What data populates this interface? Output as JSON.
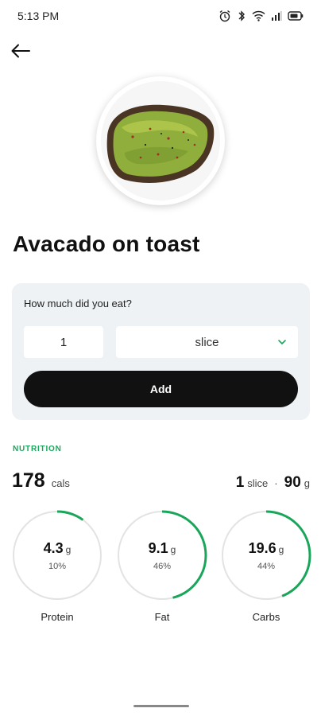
{
  "status_bar": {
    "time": "5:13 PM"
  },
  "food": {
    "title": "Avacado on toast"
  },
  "portion": {
    "question": "How much did you eat?",
    "quantity": "1",
    "unit": "slice",
    "add_label": "Add"
  },
  "nutrition": {
    "section_label": "NUTRITION",
    "calories": "178",
    "calories_unit": "cals",
    "serving_qty": "1",
    "serving_unit": "slice",
    "separator": "·",
    "serving_weight": "90",
    "serving_weight_unit": "g",
    "macros": [
      {
        "name": "Protein",
        "grams": "4.3",
        "unit": "g",
        "percent_label": "10%",
        "percent": 0.1
      },
      {
        "name": "Fat",
        "grams": "9.1",
        "unit": "g",
        "percent_label": "46%",
        "percent": 0.46
      },
      {
        "name": "Carbs",
        "grams": "19.6",
        "unit": "g",
        "percent_label": "44%",
        "percent": 0.44
      }
    ]
  },
  "colors": {
    "accent": "#1aa65a",
    "ring_track": "#e3e3e3",
    "button": "#111111",
    "card": "#eef2f4"
  }
}
